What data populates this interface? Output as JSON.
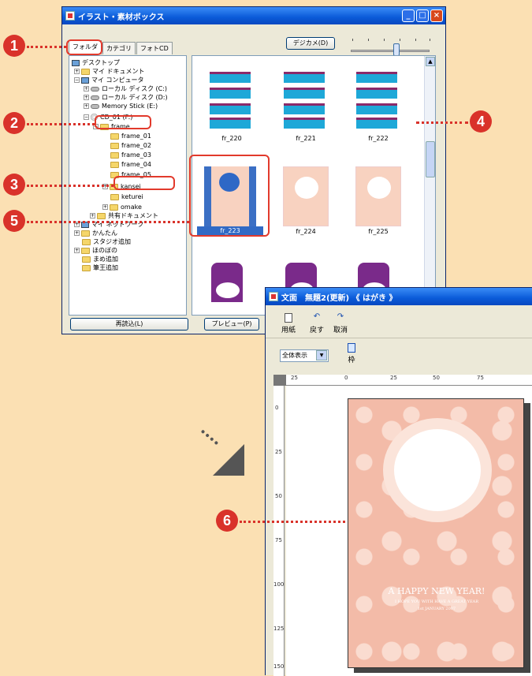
{
  "window1": {
    "title": "イラスト・素材ボックス",
    "tabs": [
      "フォルダ",
      "カテゴリ",
      "フォトCD"
    ],
    "digicam_button": "デジカメ(D)",
    "tree": [
      "デスクトップ",
      "マイ ドキュメント",
      "マイ コンピュータ",
      "ローカル ディスク (C:)",
      "ローカル ディスク (D:)",
      "Memory Stick (E:)",
      "CD_01 (F:)",
      "frame",
      "frame_01",
      "frame_02",
      "frame_03",
      "frame_04",
      "frame_05",
      "kansei",
      "keturei",
      "omake",
      "共有ドキュメント",
      "マイ ネットワーク",
      "かんたん",
      "スタジオ追加",
      "ほのぼの",
      "まめ追加",
      "筆王追加"
    ],
    "thumbnails": [
      "fr_220",
      "fr_221",
      "fr_222",
      "fr_223",
      "fr_224",
      "fr_225"
    ],
    "reload_button": "再読込(L)",
    "preview_button": "プレビュー(P)"
  },
  "window2": {
    "title": "文面　無題2(更新) 《 はがき 》",
    "toolbar": {
      "paper": "用紙",
      "back": "戻す",
      "cancel": "取消",
      "frame": "枠"
    },
    "zoom_value": "全体表示",
    "hruler_labels": [
      "25",
      "0",
      "25",
      "50",
      "75"
    ],
    "vruler_labels": [
      "0",
      "25",
      "50",
      "75",
      "100",
      "125",
      "150"
    ],
    "card": {
      "line1": "A HAPPY NEW YEAR!",
      "line2": "I HOPE YOU WITH HAVE A GREAT YEAR",
      "line3": "1st JANUARY 2007"
    }
  },
  "markers": [
    "1",
    "2",
    "3",
    "4",
    "5",
    "6"
  ],
  "colors": {
    "marker": "#d9322a",
    "background": "#fbe0b3",
    "titlebar": "#0a5ad8"
  }
}
